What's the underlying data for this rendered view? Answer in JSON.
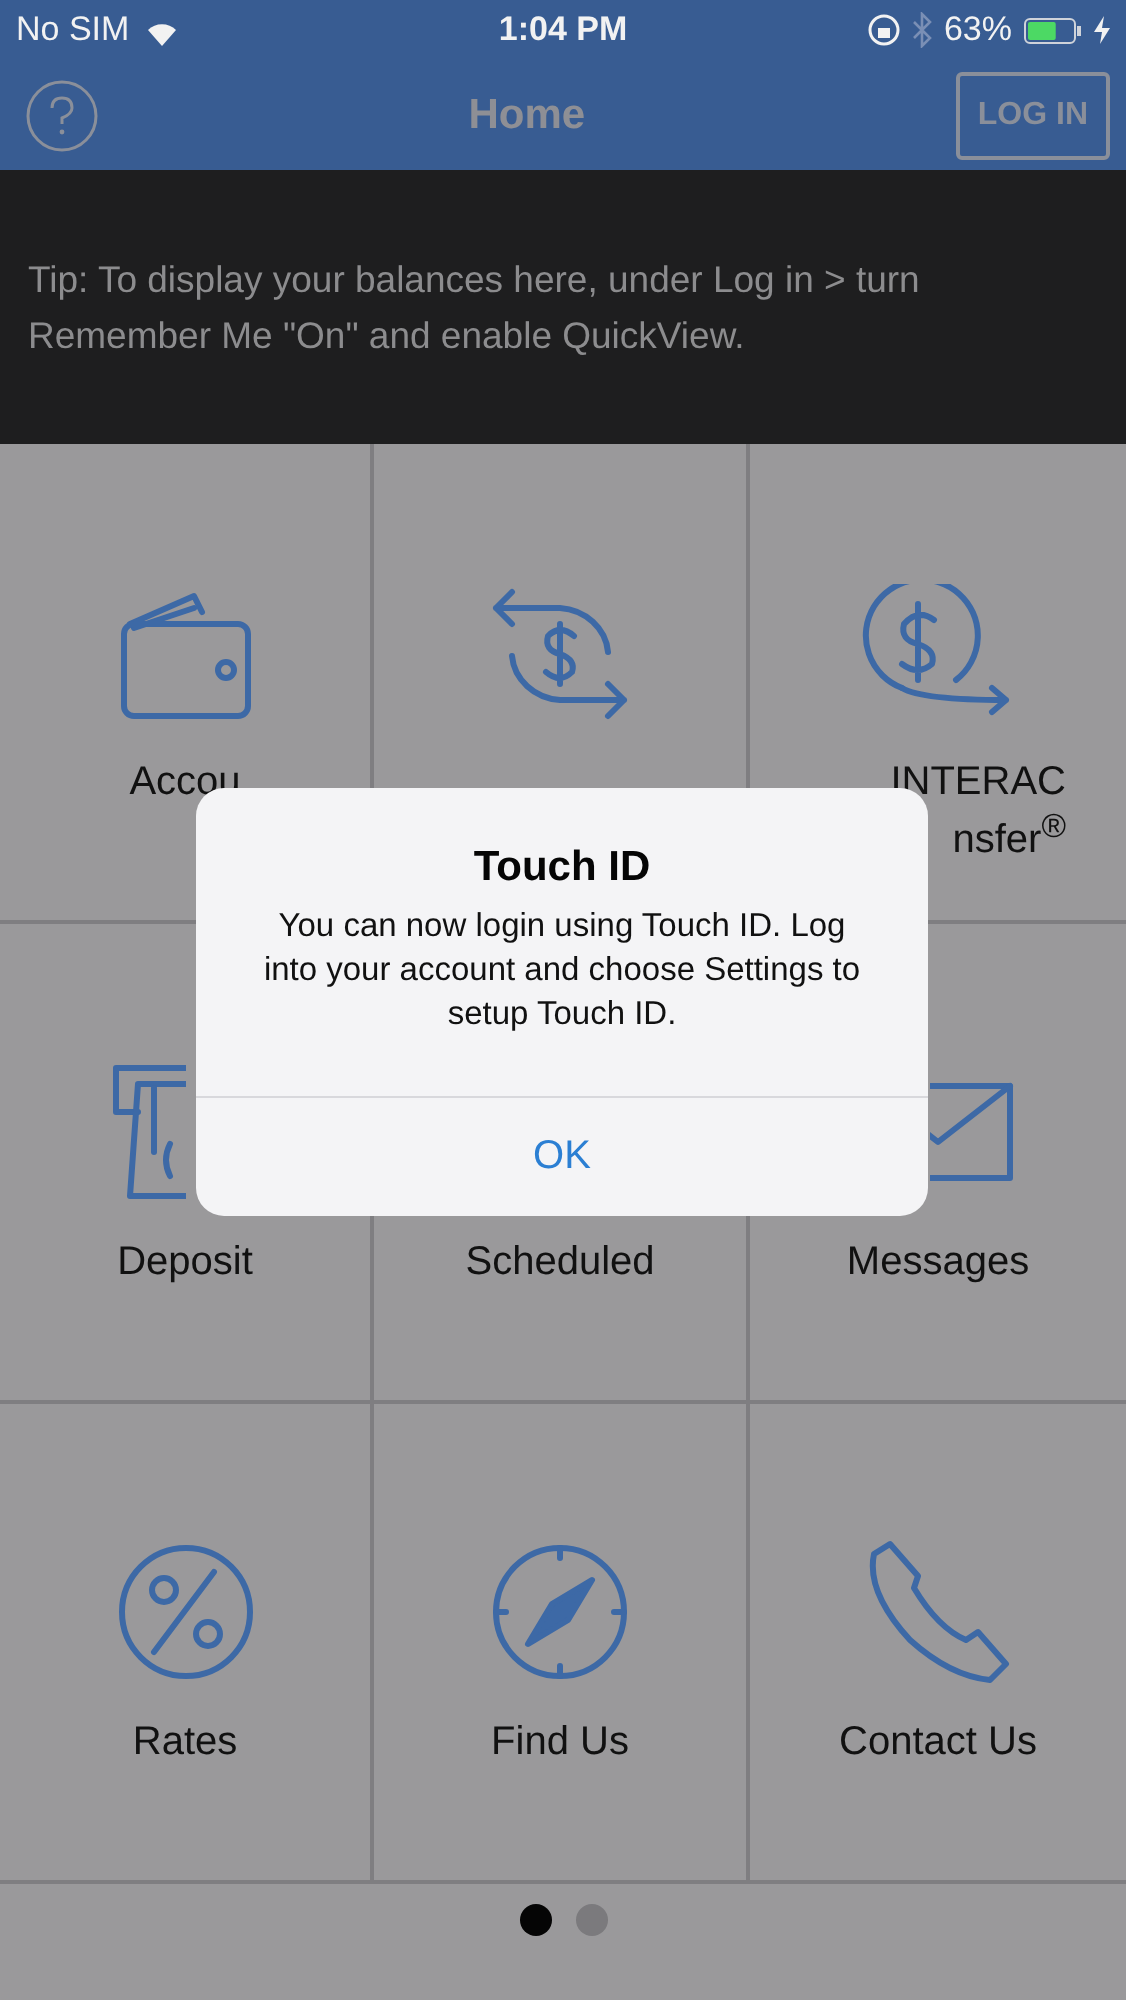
{
  "status_bar": {
    "carrier": "No SIM",
    "time": "1:04 PM",
    "battery": "63%",
    "battery_level": {
      "level": 0.63
    }
  },
  "nav": {
    "title": "Home",
    "login_button": "LOG IN"
  },
  "tip": "Tip: To display your balances here, under Log in > turn Remember Me \"On\" and enable QuickView.",
  "tiles": [
    {
      "kind": "wallet",
      "lines": [
        "Accou"
      ]
    },
    {
      "kind": "transfer"
    },
    {
      "kind": "interac",
      "lines": [
        "INTERAC",
        "nsfer$^{®}$"
      ]
    },
    {
      "kind": "deposit",
      "lines": [
        "Deposit"
      ]
    },
    {
      "kind": "scheduled",
      "lines": [
        "Scheduled"
      ]
    },
    {
      "kind": "messages",
      "lines": [
        "Messages"
      ]
    },
    {
      "kind": "rates",
      "lines": [
        "Rates"
      ]
    },
    {
      "kind": "compass",
      "lines": [
        "Find Us"
      ]
    },
    {
      "kind": "phone",
      "lines": [
        "Contact Us"
      ]
    }
  ],
  "pages": [
    {
      "selected": true
    },
    {
      "selected": false
    }
  ],
  "dialog": {
    "title": "Touch ID",
    "message": "You can now login using Touch ID. Log into your account and choose Settings to setup Touch ID.",
    "button": "OK"
  }
}
